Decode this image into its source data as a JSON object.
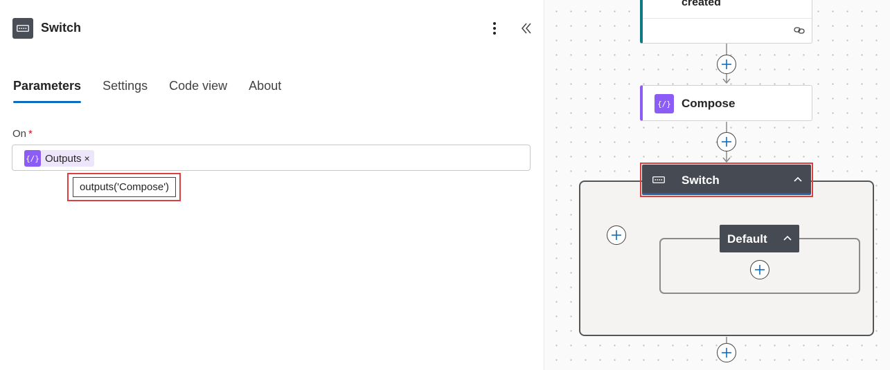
{
  "panel": {
    "title": "Switch",
    "tabs": [
      {
        "label": "Parameters",
        "active": true
      },
      {
        "label": "Settings",
        "active": false
      },
      {
        "label": "Code view",
        "active": false
      },
      {
        "label": "About",
        "active": false
      }
    ],
    "field": {
      "label": "On",
      "required_mark": "*",
      "token_label": "Outputs",
      "token_icon_text": "{/}",
      "token_remove": "×"
    },
    "tooltip": "outputs('Compose')"
  },
  "canvas": {
    "top_card_text": "created",
    "compose_label": "Compose",
    "compose_icon_text": "{/}",
    "switch_label": "Switch",
    "default_label": "Default"
  },
  "colors": {
    "accent": "#0f6cbd",
    "compose_purple": "#8b5cf6",
    "node_dark": "#464a52",
    "highlight_red": "#d94040",
    "trigger_teal": "#0e7a84"
  }
}
